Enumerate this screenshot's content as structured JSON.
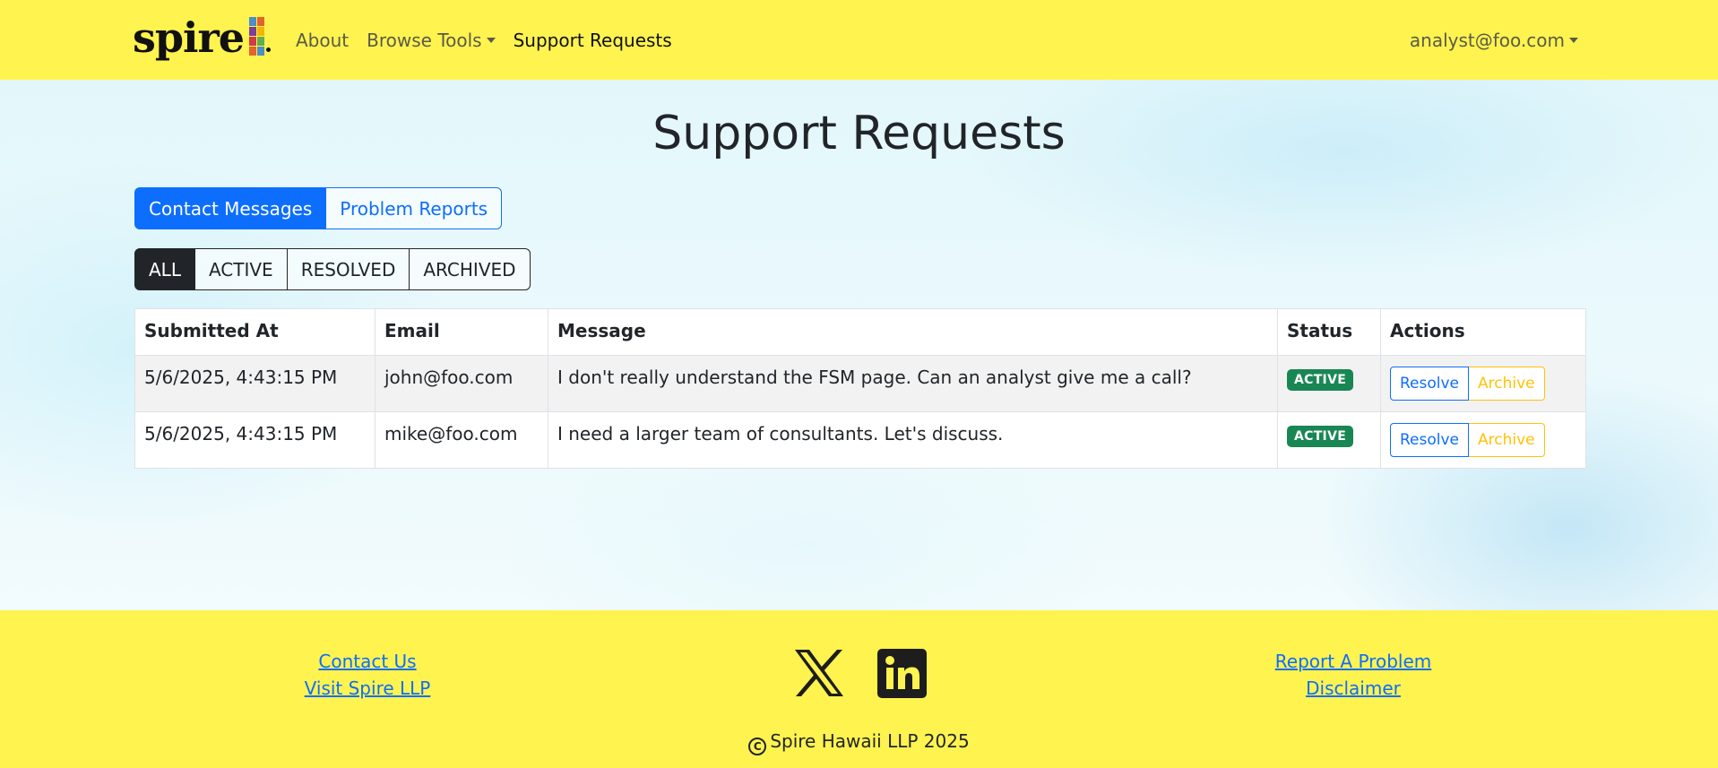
{
  "navbar": {
    "brand": "spire",
    "links": [
      {
        "label": "About"
      },
      {
        "label": "Browse Tools"
      },
      {
        "label": "Support Requests"
      }
    ],
    "user": "analyst@foo.com"
  },
  "page": {
    "title": "Support Requests",
    "tabs": [
      {
        "label": "Contact Messages",
        "active": true
      },
      {
        "label": "Problem Reports",
        "active": false
      }
    ],
    "filters": [
      {
        "label": "ALL",
        "active": true
      },
      {
        "label": "ACTIVE",
        "active": false
      },
      {
        "label": "RESOLVED",
        "active": false
      },
      {
        "label": "ARCHIVED",
        "active": false
      }
    ]
  },
  "table": {
    "headers": [
      "Submitted At",
      "Email",
      "Message",
      "Status",
      "Actions"
    ],
    "rows": [
      {
        "submitted_at": "5/6/2025, 4:43:15 PM",
        "email": "john@foo.com",
        "message": "I don't really understand the FSM page. Can an analyst give me a call?",
        "status": "ACTIVE"
      },
      {
        "submitted_at": "5/6/2025, 4:43:15 PM",
        "email": "mike@foo.com",
        "message": "I need a larger team of consultants. Let's discuss.",
        "status": "ACTIVE"
      }
    ],
    "resolve_label": "Resolve",
    "archive_label": "Archive"
  },
  "footer": {
    "contact": "Contact Us",
    "visit": "Visit Spire LLP",
    "report": "Report A Problem",
    "disclaimer": "Disclaimer",
    "copyright": "Spire Hawaii LLP 2025",
    "social_icons": [
      "x-logo-icon",
      "linkedin-icon"
    ]
  },
  "colors": {
    "navbar_bg": "#fff34f",
    "primary": "#0d6efd",
    "dark": "#212529",
    "success": "#198754",
    "warning": "#ffc107"
  }
}
